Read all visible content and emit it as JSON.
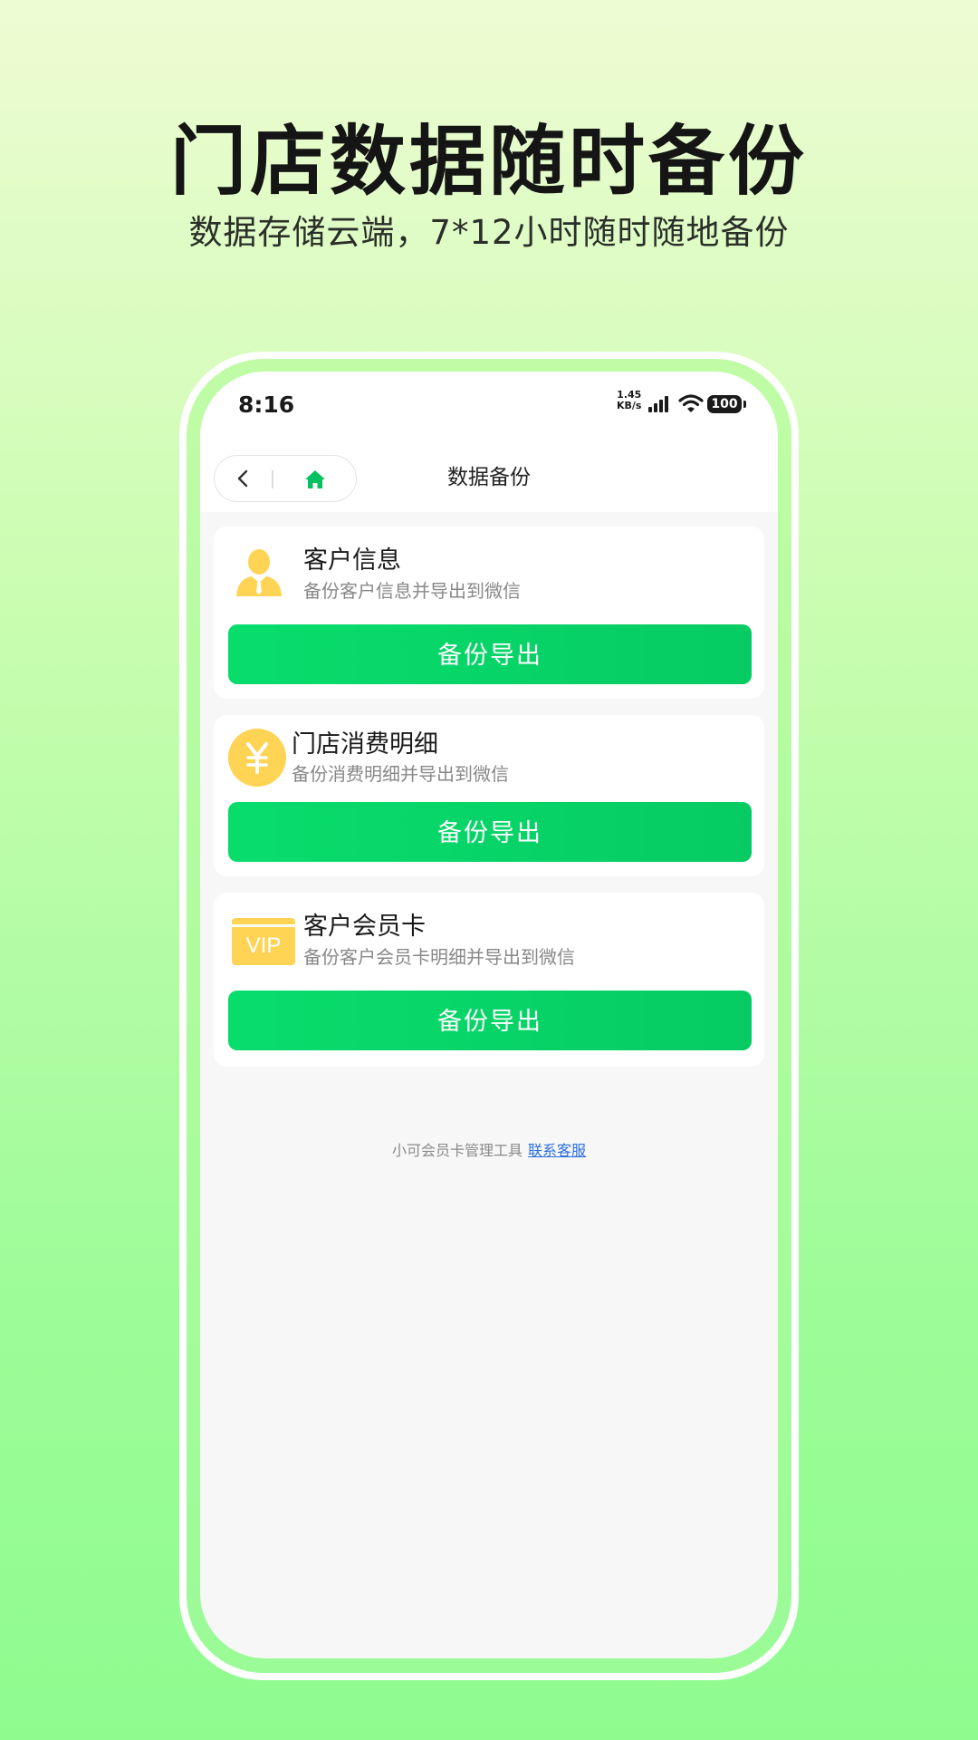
{
  "promo": {
    "headline": "门店数据随时备份",
    "subline": "数据存储云端，7*12小时随时随地备份"
  },
  "status_bar": {
    "time": "8:16",
    "speed_value": "1.45",
    "speed_unit": "KB/s",
    "battery": "100"
  },
  "navbar": {
    "title": "数据备份",
    "back_icon": "chevron-left-icon",
    "home_icon": "home-icon",
    "home_color": "#07c160"
  },
  "cards": [
    {
      "icon": "user-icon",
      "title": "客户信息",
      "desc": "备份客户信息并导出到微信",
      "button": "备份导出"
    },
    {
      "icon": "yen-coin-icon",
      "title": "门店消费明细",
      "desc": "备份消费明细并导出到微信",
      "button": "备份导出"
    },
    {
      "icon": "vip-card-icon",
      "icon_text": "VIP",
      "title": "客户会员卡",
      "desc": "备份客户会员卡明细并导出到微信",
      "button": "备份导出"
    }
  ],
  "footer": {
    "text": "小可会员卡管理工具",
    "link": "联系客服"
  },
  "colors": {
    "accent_green": "#07c160",
    "icon_yellow": "#ffd354",
    "link_blue": "#2b6fe0"
  }
}
